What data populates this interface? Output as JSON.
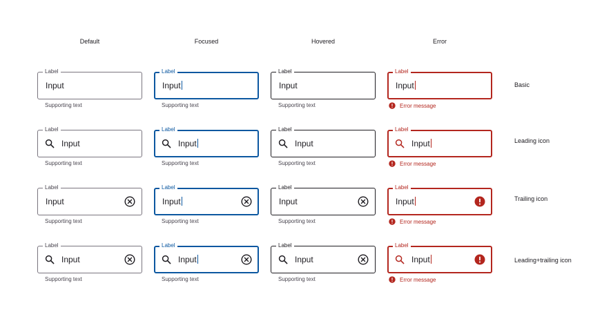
{
  "columns": [
    "Default",
    "Focused",
    "Hovered",
    "Error"
  ],
  "rows": [
    "Basic",
    "Leading icon",
    "Trailing icon",
    "Leading+trailing icon"
  ],
  "field": {
    "label": "Label",
    "input": "Input",
    "supporting_text": "Supporting text",
    "error_message": "Error message"
  },
  "icons": {
    "leading": "search-icon",
    "trailing": "clear-icon",
    "error_trailing": "error-icon"
  },
  "colors": {
    "focused": "#0b57a0",
    "error": "#b3261e",
    "outline": "#79747e",
    "hover_outline": "#1d1b20",
    "text": "#1d1b20",
    "supporting": "#49454f"
  }
}
